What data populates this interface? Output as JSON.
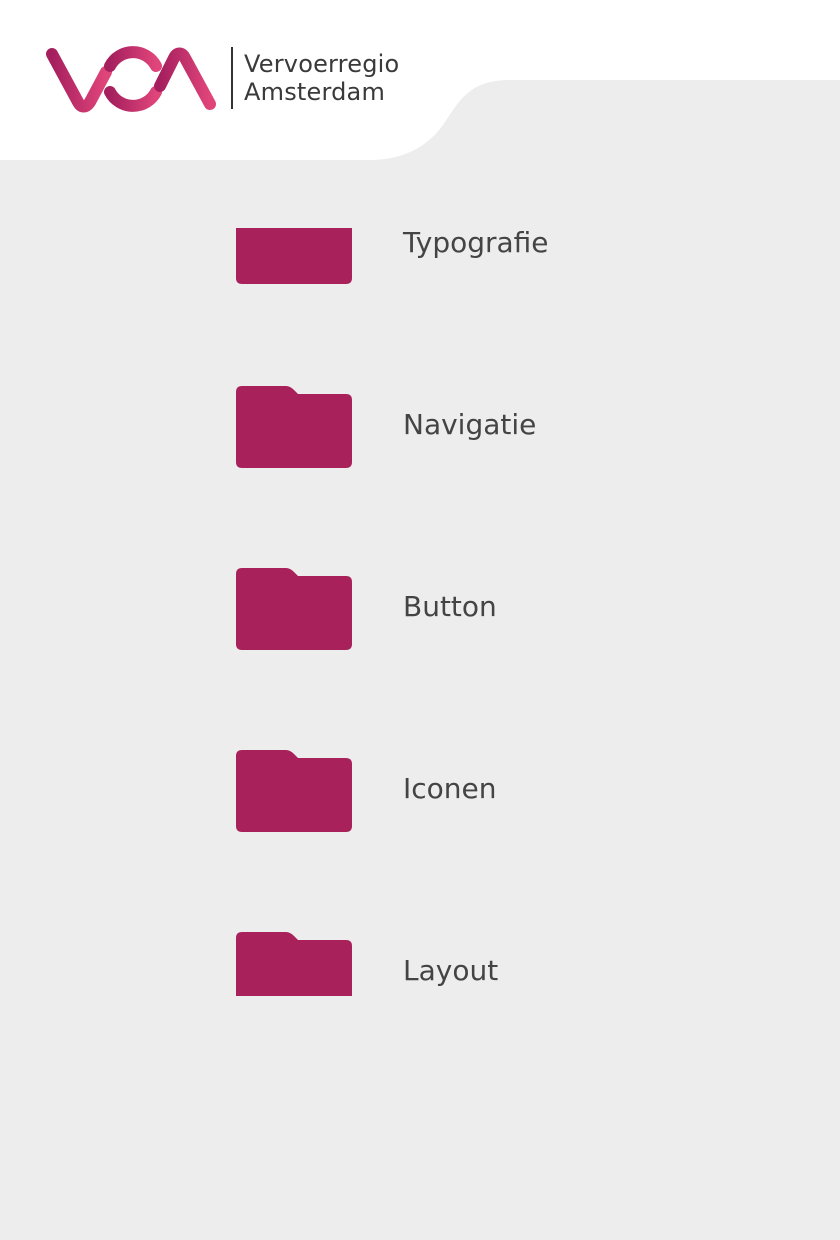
{
  "header": {
    "logo": {
      "mark_letters": "VRA",
      "line1": "Vervoerregio",
      "line2": "Amsterdam"
    }
  },
  "folders": [
    {
      "label": "Typografie",
      "icon": "folder-icon"
    },
    {
      "label": "Navigatie",
      "icon": "folder-icon"
    },
    {
      "label": "Button",
      "icon": "folder-icon"
    },
    {
      "label": "Iconen",
      "icon": "folder-icon"
    },
    {
      "label": "Layout",
      "icon": "folder-icon"
    }
  ],
  "colors": {
    "background": "#ededed",
    "header_background": "#ffffff",
    "folder": "#a8215a",
    "logo_gradient_start": "#a51f5e",
    "logo_gradient_end": "#e0457a",
    "text": "#444444"
  }
}
